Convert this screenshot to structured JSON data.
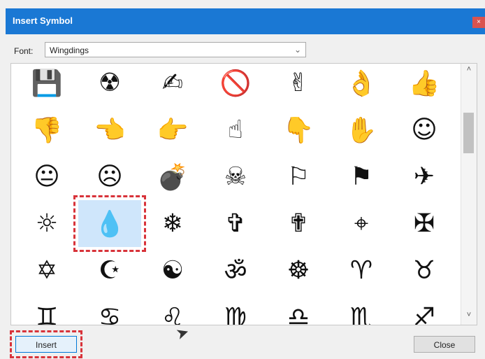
{
  "window": {
    "title": "Insert Symbol",
    "close_glyph": "×"
  },
  "font_row": {
    "label": "Font:",
    "value": "Wingdings",
    "chevron": "⌄"
  },
  "symbols": [
    [
      "💾",
      "☢",
      "✍",
      "🚫",
      "✌",
      "👌",
      "👍"
    ],
    [
      "👎",
      "👈",
      "👉",
      "☝",
      "👇",
      "✋",
      "☺"
    ],
    [
      "😐",
      "☹",
      "💣",
      "☠",
      "⚐",
      "⚑",
      "✈"
    ],
    [
      "☼",
      "💧",
      "❄",
      "✞",
      "✟",
      "⌖",
      "✠"
    ],
    [
      "✡",
      "☪",
      "☯",
      "ॐ",
      "☸",
      "♈",
      "♉"
    ],
    [
      "♊",
      "♋",
      "♌",
      "♍",
      "♎",
      "♏",
      "♐"
    ]
  ],
  "selected_symbol": {
    "row": 3,
    "col": 1
  },
  "scrollbar": {
    "up": "˄",
    "down": "˅"
  },
  "buttons": {
    "insert": "Insert",
    "close": "Close"
  },
  "colors": {
    "title_bar": "#1a78d4",
    "highlight_dash": "#d8333a",
    "selected_bg": "#cfe6fb"
  }
}
